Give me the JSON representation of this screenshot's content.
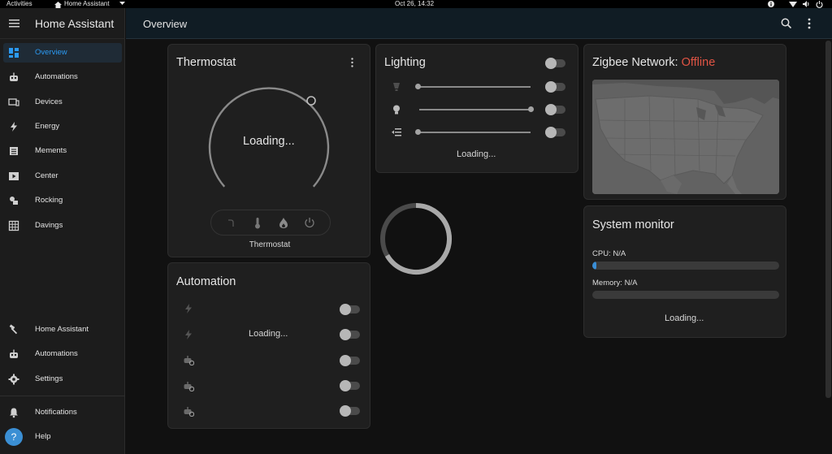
{
  "topbar": {
    "activities": "Activities",
    "app_menu": "Home Assistant",
    "clock": "Oct 26, 14:32"
  },
  "sidebar": {
    "title": "Home Assistant",
    "items": [
      {
        "label": "Overview",
        "icon": "dashboard-icon",
        "active": true
      },
      {
        "label": "Automations",
        "icon": "robot-icon"
      },
      {
        "label": "Devices",
        "icon": "devices-icon"
      },
      {
        "label": "Energy",
        "icon": "lightning-icon"
      },
      {
        "label": "Mements",
        "icon": "list-icon"
      },
      {
        "label": "Center",
        "icon": "media-icon"
      },
      {
        "label": "Rocking",
        "icon": "shapes-icon"
      },
      {
        "label": "Davings",
        "icon": "grid-icon"
      }
    ],
    "bottom_items": [
      {
        "label": "Home Assistant",
        "icon": "hammer-icon"
      },
      {
        "label": "Automations",
        "icon": "robot-icon"
      },
      {
        "label": "Settings",
        "icon": "gear-icon"
      }
    ],
    "notifications_label": "Notifications",
    "help_label": "Help",
    "help_symbol": "?"
  },
  "header": {
    "title": "Overview"
  },
  "thermostat": {
    "title": "Thermostat",
    "status": "Loading...",
    "label": "Thermostat"
  },
  "lighting": {
    "title": "Lighting",
    "status": "Loading..."
  },
  "zigbee": {
    "title": "Zigbee Network: ",
    "status": "Offline",
    "status_color": "#e05444"
  },
  "automation": {
    "title": "Automation",
    "status": "Loading..."
  },
  "monitor": {
    "title": "System monitor",
    "cpu_label": "CPU: N/A",
    "memory_label": "Memory: N/A",
    "status": "Loading...",
    "cpu_fraction": 0.02,
    "memory_fraction": 0
  },
  "colors": {
    "accent": "#2b9af3",
    "offline": "#e05444"
  }
}
